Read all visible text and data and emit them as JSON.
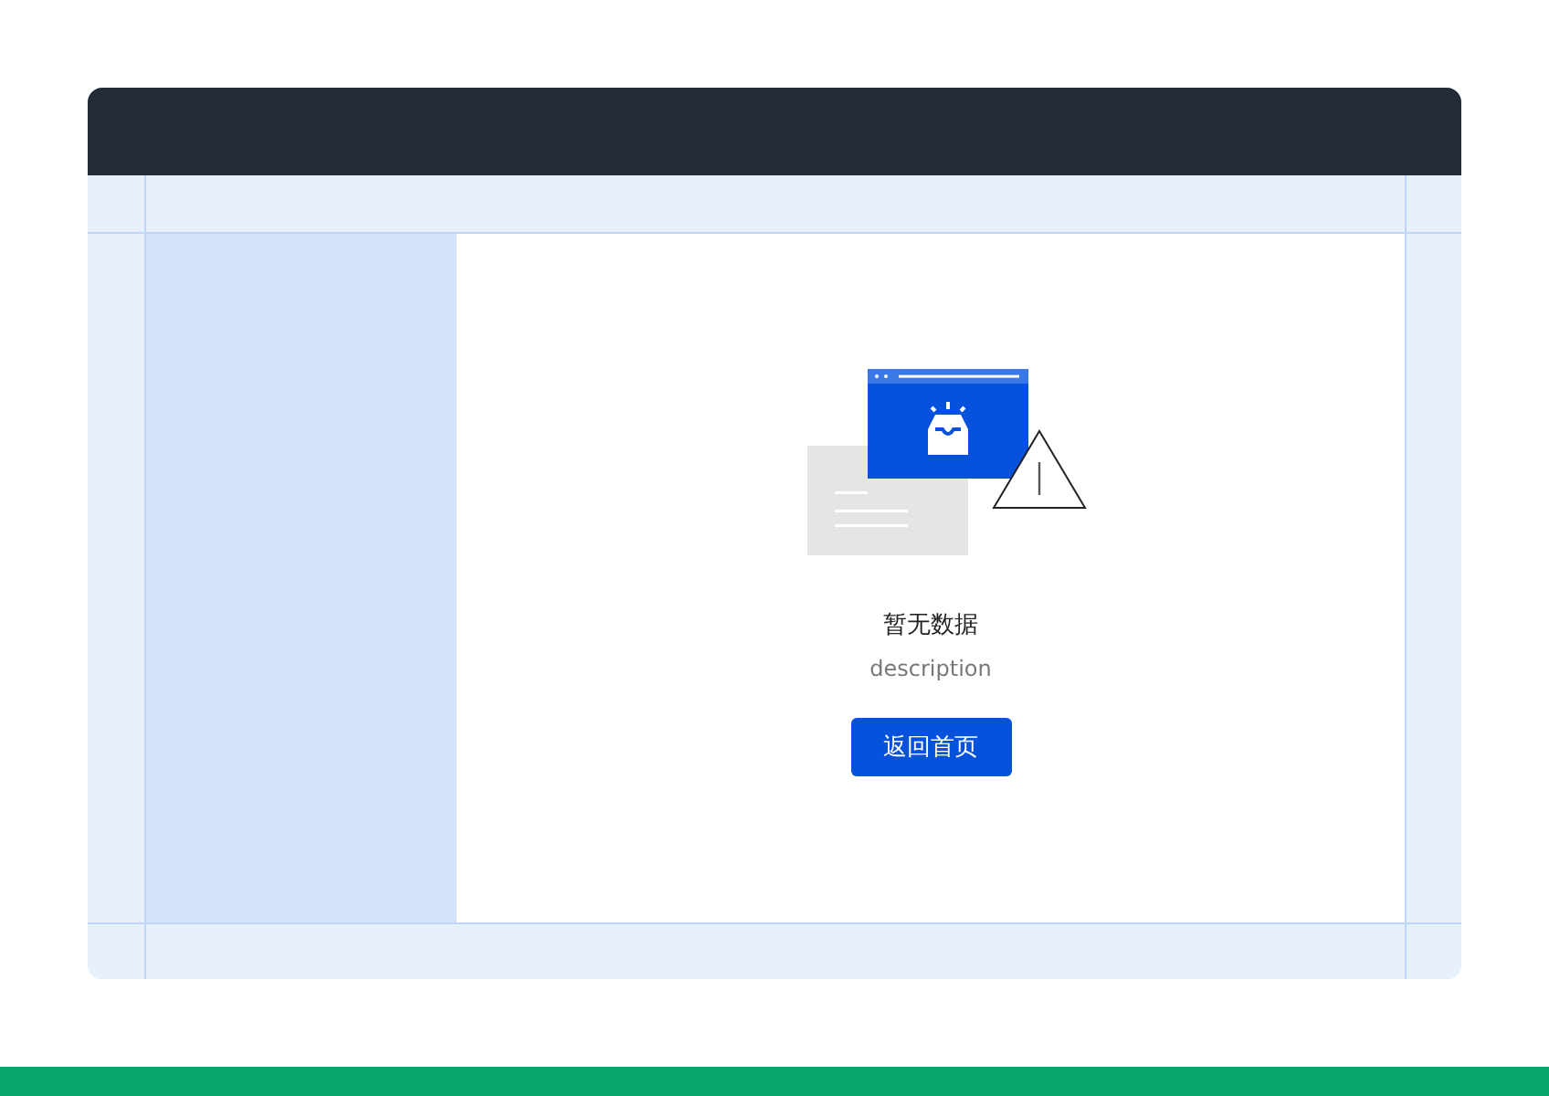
{
  "empty_state": {
    "title": "暂无数据",
    "description": "description",
    "button": "返回首页"
  }
}
